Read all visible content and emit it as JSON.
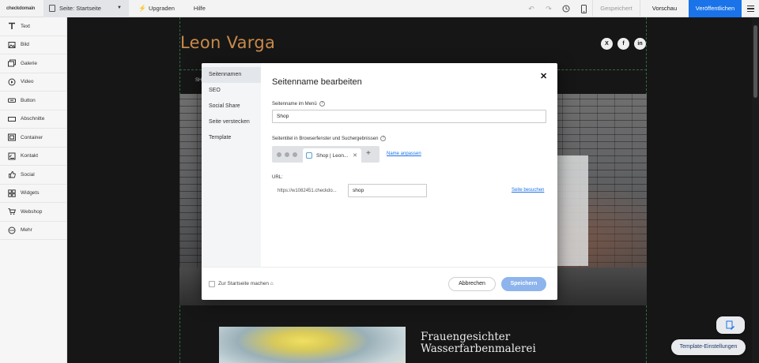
{
  "topbar": {
    "brand": "checkdomain",
    "page_select": "Seite: Startseite",
    "upgrade": "Upgraden",
    "help": "Hilfe",
    "saved": "Gespeichert",
    "preview": "Vorschau",
    "publish": "Veröffentlichen"
  },
  "sidebar": {
    "items": [
      {
        "label": "Text",
        "icon": "text-icon"
      },
      {
        "label": "Bild",
        "icon": "image-icon"
      },
      {
        "label": "Galerie",
        "icon": "gallery-icon"
      },
      {
        "label": "Video",
        "icon": "video-icon"
      },
      {
        "label": "Button",
        "icon": "button-icon"
      },
      {
        "label": "Abschnitte",
        "icon": "sections-icon"
      },
      {
        "label": "Container",
        "icon": "container-icon"
      },
      {
        "label": "Kontakt",
        "icon": "contact-icon"
      },
      {
        "label": "Social",
        "icon": "social-icon"
      },
      {
        "label": "Widgets",
        "icon": "widgets-icon"
      },
      {
        "label": "Webshop",
        "icon": "cart-icon"
      },
      {
        "label": "Mehr",
        "icon": "more-icon"
      }
    ]
  },
  "site": {
    "name": "Leon Varga",
    "nav_fragment": "SH",
    "social": [
      "X",
      "f",
      "in"
    ],
    "painting_title_line1": "Frauengesichter",
    "painting_title_line2": "Wasserfarbenmalerei"
  },
  "modal": {
    "tabs": [
      "Seitennamen",
      "SEO",
      "Social Share",
      "Seite verstecken",
      "Template"
    ],
    "active_tab": "Seitennamen",
    "title": "Seitenname bearbeiten",
    "menu_name_label": "Seitenname im Menü",
    "menu_name_value": "Shop",
    "browser_title_label": "Seitentitel in Browserfenster und Suchergebnissen",
    "browser_tab_text": "Shop | Leon...",
    "rename_link": "Name anpassen",
    "url_label": "URL:",
    "url_prefix": "https://w1082451.checkdo...",
    "url_slug": "shop",
    "visit_link": "Seite besuchen",
    "homepage_checkbox": "Zur Startseite machen",
    "cancel": "Abbrechen",
    "save": "Speichern"
  },
  "floating": {
    "template_settings": "Template-Einstellungen"
  },
  "colors": {
    "accent": "#1a73e8",
    "site_name": "#c98a4a",
    "save_disabled": "#8db4ec"
  }
}
